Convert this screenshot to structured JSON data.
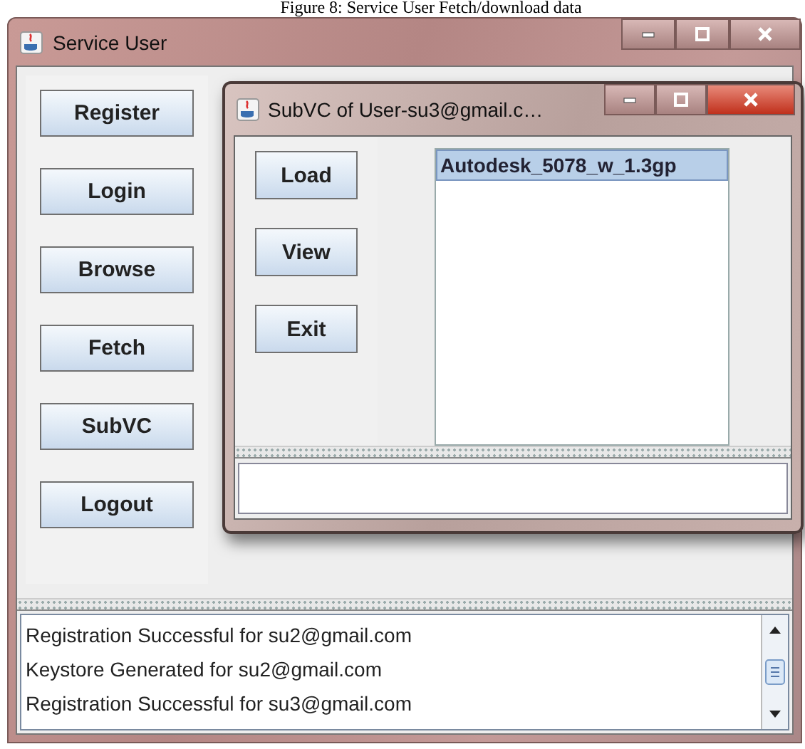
{
  "caption": "Figure 8: Service User Fetch/download data",
  "window": {
    "title": "Service User"
  },
  "buttons": [
    "Register",
    "Login",
    "Browse",
    "Fetch",
    "SubVC",
    "Logout"
  ],
  "sub_window": {
    "title": "SubVC of User-su3@gmail.c…",
    "buttons": [
      "Load",
      "View",
      "Exit"
    ],
    "list": [
      {
        "text": "Autodesk_5078_w_1.3gp",
        "selected": true
      }
    ]
  },
  "log": [
    "Registration Successful for su2@gmail.com",
    "Keystore Generated for su2@gmail.com",
    "Registration Successful for su3@gmail.com"
  ]
}
